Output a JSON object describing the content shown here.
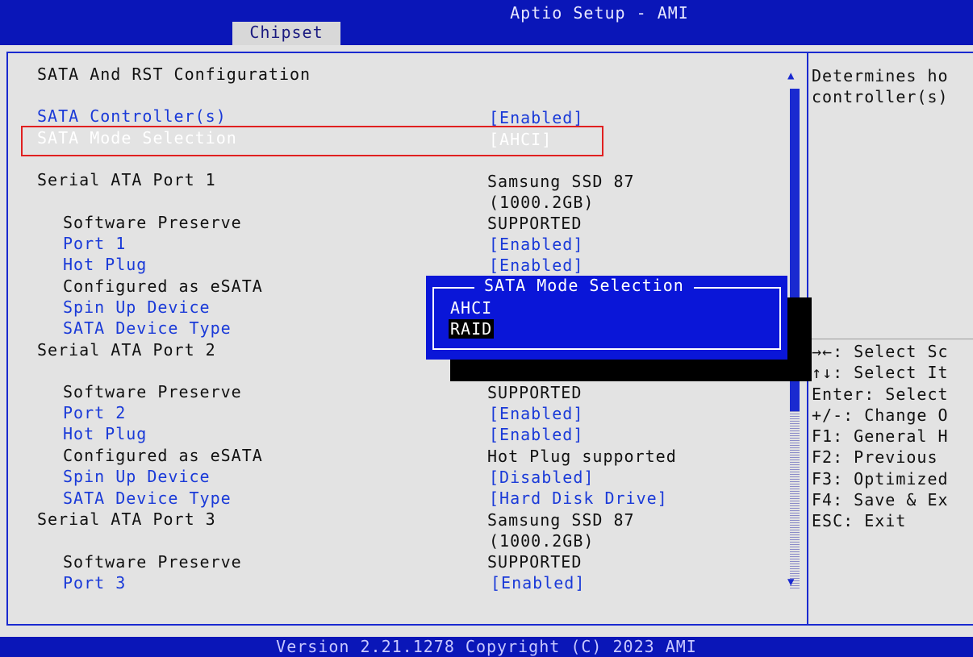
{
  "header": {
    "app_title": "Aptio Setup - AMI",
    "tab": "Chipset"
  },
  "section_title": "SATA And RST Configuration",
  "rows": [
    {
      "label": "SATA Controller(s)",
      "value": "[Enabled]"
    },
    {
      "label": "SATA Mode Selection",
      "value": "[AHCI]"
    },
    {
      "label": "Serial ATA Port 1",
      "value": "Samsung SSD 87"
    },
    {
      "label": "",
      "value": "(1000.2GB)"
    },
    {
      "label": "Software Preserve",
      "value": "SUPPORTED"
    },
    {
      "label": "Port 1",
      "value": "[Enabled]"
    },
    {
      "label": "Hot Plug",
      "value": "[Enabled]"
    },
    {
      "label": "Configured as eSATA",
      "value": ""
    },
    {
      "label": "Spin Up Device",
      "value": ""
    },
    {
      "label": "SATA Device Type",
      "value": ""
    },
    {
      "label": "Serial ATA Port 2",
      "value": ""
    },
    {
      "label": "Software Preserve",
      "value": "SUPPORTED"
    },
    {
      "label": "Port 2",
      "value": "[Enabled]"
    },
    {
      "label": "Hot Plug",
      "value": "[Enabled]"
    },
    {
      "label": "Configured as eSATA",
      "value": "Hot Plug supported"
    },
    {
      "label": "Spin Up Device",
      "value": "[Disabled]"
    },
    {
      "label": "SATA Device Type",
      "value": "[Hard Disk Drive]"
    },
    {
      "label": "Serial ATA Port 3",
      "value": "Samsung SSD 87"
    },
    {
      "label": "",
      "value": "(1000.2GB)"
    },
    {
      "label": "Software Preserve",
      "value": "SUPPORTED"
    },
    {
      "label": "Port 3",
      "value": "[Enabled]"
    }
  ],
  "help": {
    "line1": "Determines ho",
    "line2": "controller(s)"
  },
  "keys": [
    "→←: Select Sc",
    "↑↓: Select It",
    "Enter: Select",
    "+/-: Change O",
    "F1: General H",
    "F2: Previous",
    "F3: Optimized",
    "F4: Save & Ex",
    "ESC: Exit"
  ],
  "popup": {
    "title": "SATA Mode Selection",
    "options": [
      "AHCI",
      "RAID"
    ],
    "selected": "RAID"
  },
  "scroll": {
    "up": "▲",
    "down": "▼"
  },
  "footer": "Version 2.21.1278 Copyright (C) 2023 AMI",
  "colors": {
    "background": "#0a16b8",
    "panel": "#e3e3e3",
    "selectable_text": "#1a3ad8",
    "highlight_box": "#e02020"
  }
}
